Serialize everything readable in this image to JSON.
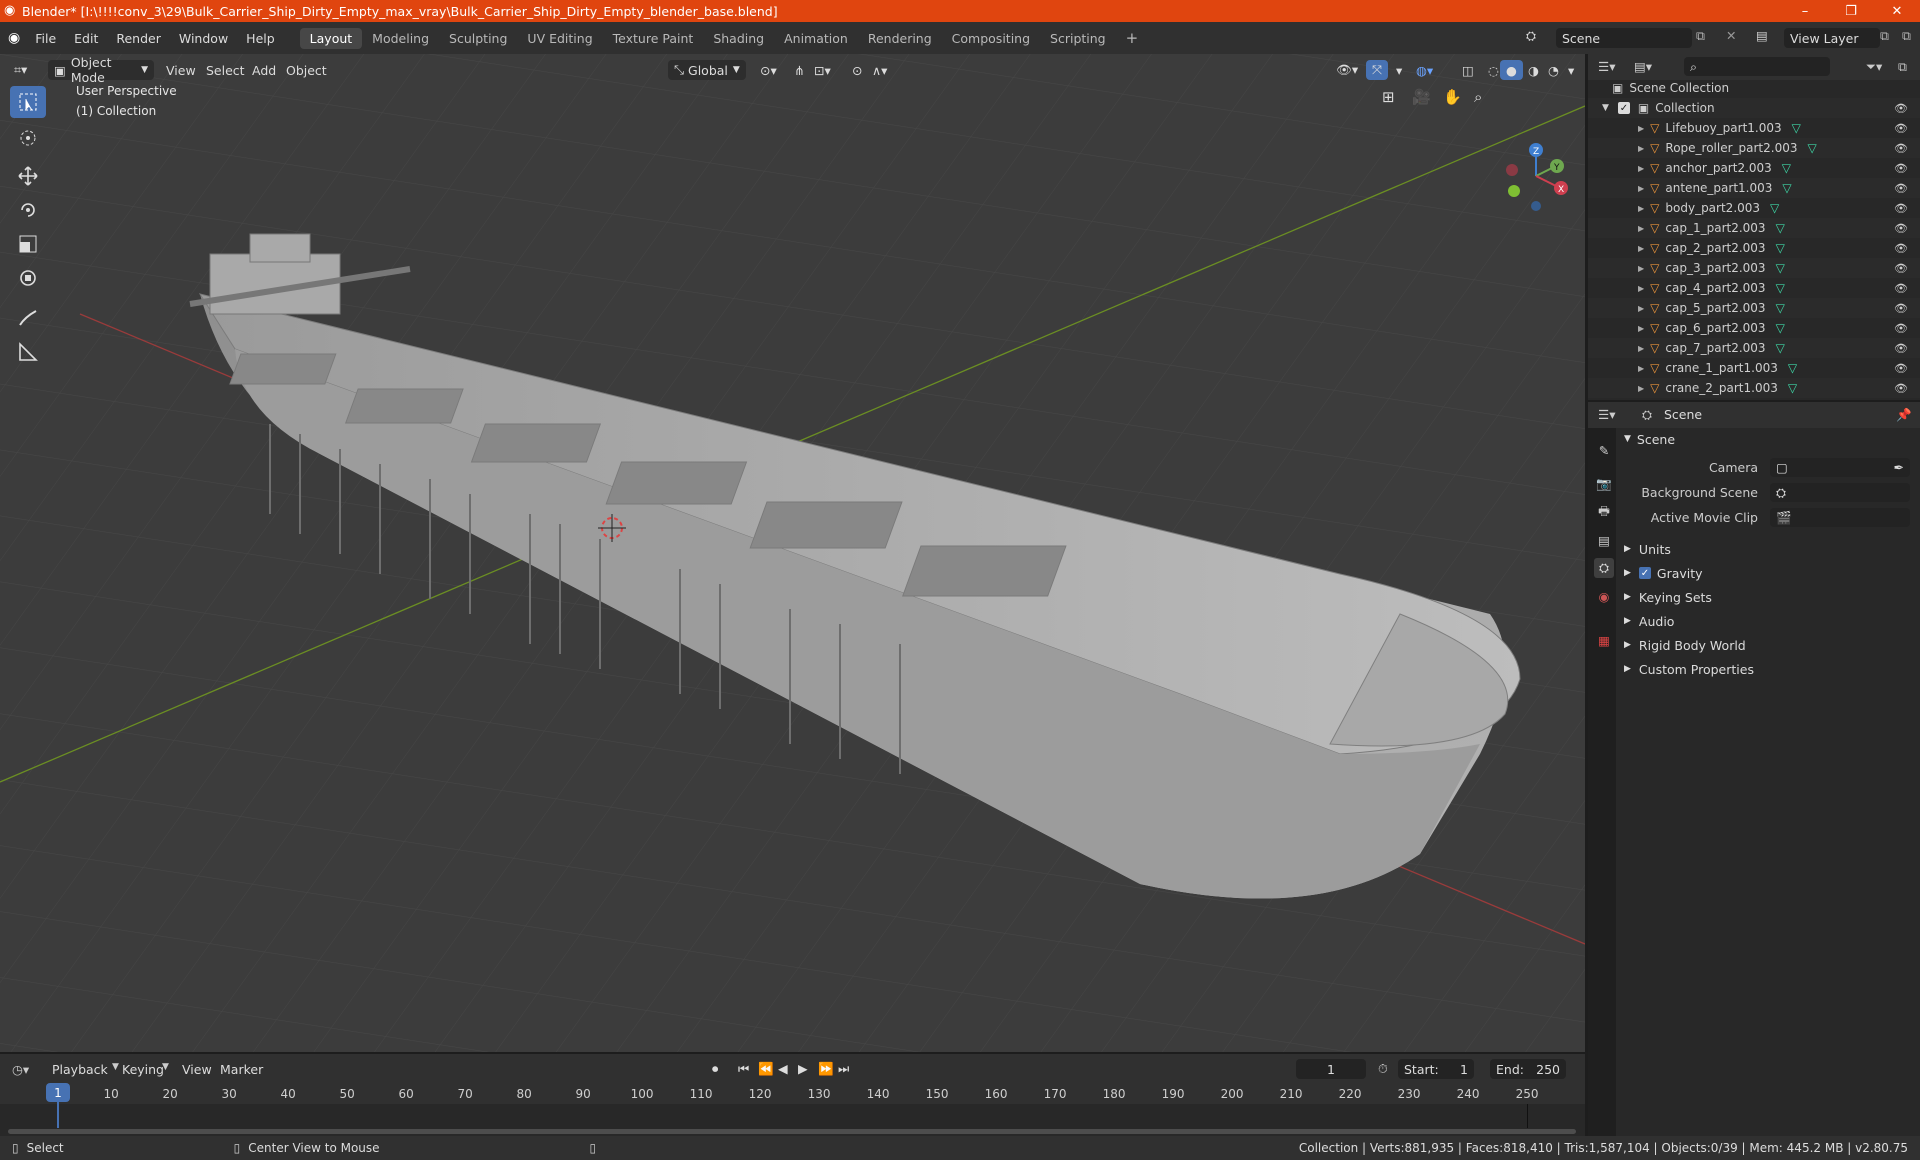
{
  "window": {
    "title": "Blender* [I:\\!!!!conv_3\\29\\Bulk_Carrier_Ship_Dirty_Empty_max_vray\\Bulk_Carrier_Ship_Dirty_Empty_blender_base.blend]",
    "minimize": "–",
    "maximize": "❐",
    "close": "✕"
  },
  "menus": [
    "File",
    "Edit",
    "Render",
    "Window",
    "Help"
  ],
  "workspaces": [
    "Layout",
    "Modeling",
    "Sculpting",
    "UV Editing",
    "Texture Paint",
    "Shading",
    "Animation",
    "Rendering",
    "Compositing",
    "Scripting"
  ],
  "active_workspace": "Layout",
  "scene_field": "Scene",
  "view_layer_field": "View Layer",
  "viewport": {
    "mode": "Object Mode",
    "menu_view": "View",
    "menu_select": "Select",
    "menu_add": "Add",
    "menu_object": "Object",
    "orientation": "Global",
    "overlay_title": "User Perspective",
    "overlay_collection": "(1) Collection",
    "gizmo": {
      "z": "Z",
      "y": "Y",
      "x": "X"
    }
  },
  "outliner": {
    "root": "Scene Collection",
    "collection": "Collection",
    "items": [
      "Lifebuoy_part1.003",
      "Rope_roller_part2.003",
      "anchor_part2.003",
      "antene_part1.003",
      "body_part2.003",
      "cap_1_part2.003",
      "cap_2_part2.003",
      "cap_3_part2.003",
      "cap_4_part2.003",
      "cap_5_part2.003",
      "cap_6_part2.003",
      "cap_7_part2.003",
      "crane_1_part1.003",
      "crane_2_part1.003"
    ]
  },
  "properties": {
    "header": "Scene",
    "panel": "Scene",
    "camera_label": "Camera",
    "bg_scene_label": "Background Scene",
    "movie_clip_label": "Active Movie Clip",
    "sections": [
      "Units",
      "Gravity",
      "Keying Sets",
      "Audio",
      "Rigid Body World",
      "Custom Properties"
    ],
    "gravity_checked": true
  },
  "timeline": {
    "menus": [
      "Playback",
      "Keying",
      "View",
      "Marker"
    ],
    "current_frame": "1",
    "start_label": "Start:",
    "start": "1",
    "end_label": "End:",
    "end": "250",
    "ticks": [
      "1",
      "10",
      "20",
      "30",
      "40",
      "50",
      "60",
      "70",
      "80",
      "90",
      "100",
      "110",
      "120",
      "130",
      "140",
      "150",
      "160",
      "170",
      "180",
      "190",
      "200",
      "210",
      "220",
      "230",
      "240",
      "250"
    ]
  },
  "status": {
    "select": "Select",
    "center": "Center View to Mouse",
    "stats": "Collection | Verts:881,935 | Faces:818,410 | Tris:1,587,104 | Objects:0/39 | Mem: 445.2 MB | v2.80.75"
  },
  "colors": {
    "title_bar": "#e0450f",
    "accent": "#4772b3",
    "object_icon": "#e8923a",
    "mesh_icon": "#3ed6a5"
  }
}
